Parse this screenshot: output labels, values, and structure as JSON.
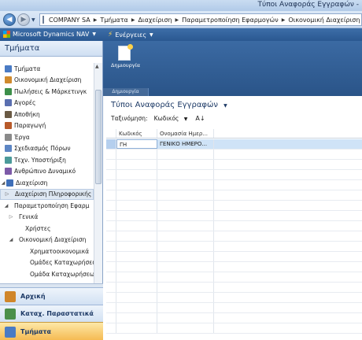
{
  "window": {
    "title": "Τύποι Αναφοράς Εγγραφών -"
  },
  "address": {
    "crumbs": [
      "COMPANY SA",
      "Τμήματα",
      "Διαχείριση",
      "Παραμετροποίηση Εφαρμογών",
      "Οικονομική Διαχείριση"
    ]
  },
  "menubar": {
    "app_label": "Microsoft Dynamics NAV",
    "actions_label": "Ενέργειες"
  },
  "nav": {
    "header": "Τμήματα",
    "items": [
      {
        "label": "Τμήματα",
        "color": "#4a7bc4"
      },
      {
        "label": "Οικονομική Διαχείριση",
        "color": "#d08a2e"
      },
      {
        "label": "Πωλήσεις & Μάρκετινγκ",
        "color": "#3d8f4a"
      },
      {
        "label": "Αγορές",
        "color": "#5a6fb0"
      },
      {
        "label": "Αποθήκη",
        "color": "#6a5a44"
      },
      {
        "label": "Παραγωγή",
        "color": "#b85a2a"
      },
      {
        "label": "Έργα",
        "color": "#8a8a8a"
      },
      {
        "label": "Σχεδιασμός Πόρων",
        "color": "#5d86c4"
      },
      {
        "label": "Τεχν. Υποστήριξη",
        "color": "#4b9a9a"
      },
      {
        "label": "Ανθρώπινο Δυναμικό",
        "color": "#7d5aa8"
      },
      {
        "label": "Διαχείριση",
        "color": "#3f6fb8"
      },
      {
        "label": "Διαχείριση Πληροφορικής"
      },
      {
        "label": "Παραμετροποίηση Εφαρμ"
      },
      {
        "label": "Γενικά"
      },
      {
        "label": "Χρήστες"
      },
      {
        "label": "Οικονομική Διαχείριση"
      },
      {
        "label": "Χρηματοοικονομικά"
      },
      {
        "label": "Ομάδες Καταχωρήσεω"
      },
      {
        "label": "Ομάδα Καταχωρήσεω"
      }
    ],
    "buttons": [
      {
        "label": "Αρχική",
        "color": "#d0862a"
      },
      {
        "label": "Καταχ. Παραστατικά",
        "color": "#4a8f4a"
      },
      {
        "label": "Τμήματα",
        "color": "#4a7bc4"
      }
    ]
  },
  "ribbon": {
    "new_label": "Δημιουργία",
    "group_label": "Δημιουργία"
  },
  "page": {
    "title": "Τύποι Αναφοράς Εγγραφών",
    "sort_label": "Ταξινόμηση:",
    "sort_value": "Κωδικός",
    "sort_dir": "↓",
    "columns": [
      "Κωδικός",
      "Ονομασία Ημερ..."
    ],
    "rows": [
      {
        "code": "ΓΗ",
        "name": "ΓΕΝΙΚΟ ΗΜΕΡΟ..."
      }
    ]
  }
}
